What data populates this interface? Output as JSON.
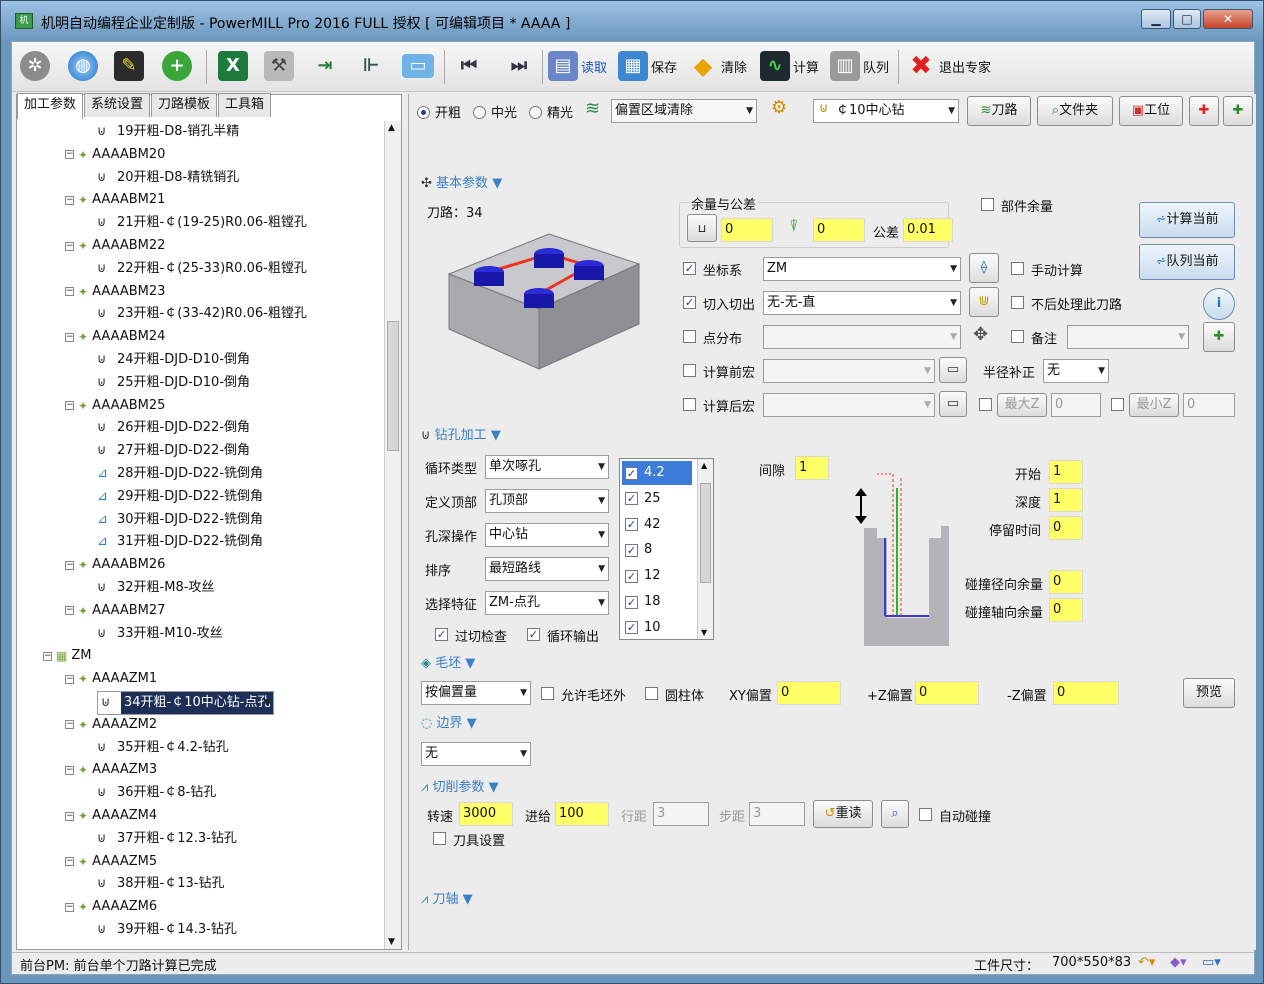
{
  "window": {
    "title": "机明自动编程企业定制版 - PowerMILL Pro 2016 FULL 授权 [ 可编辑项目 * AAAA ]",
    "app_icon": "机"
  },
  "toolbar": {
    "items": [
      {
        "icon": "gear-icon"
      },
      {
        "icon": "globe-icon"
      },
      {
        "icon": "wizard-icon"
      },
      {
        "icon": "add-icon"
      },
      {
        "icon": "excel-icon"
      },
      {
        "icon": "wrench-icon"
      },
      {
        "icon": "import-icon"
      },
      {
        "icon": "tree-icon"
      },
      {
        "icon": "folder-icon"
      },
      {
        "icon": "first-icon"
      },
      {
        "icon": "last-icon"
      }
    ],
    "read_label": "读取",
    "save_label": "保存",
    "clear_label": "清除",
    "calc_label": "计算",
    "queue_label": "队列",
    "exit_label": "退出专家"
  },
  "left_tabs": [
    "加工参数",
    "系统设置",
    "刀路模板",
    "工具箱"
  ],
  "tree": [
    {
      "level": 2,
      "text": "19开粗-D8-销孔半精",
      "type": "op"
    },
    {
      "level": 1,
      "text": "AAAABM20",
      "type": "group"
    },
    {
      "level": 2,
      "text": "20开粗-D8-精铣销孔",
      "type": "op"
    },
    {
      "level": 1,
      "text": "AAAABM21",
      "type": "group"
    },
    {
      "level": 2,
      "text": "21开粗-￠(19-25)R0.06-粗镗孔",
      "type": "op"
    },
    {
      "level": 1,
      "text": "AAAABM22",
      "type": "group"
    },
    {
      "level": 2,
      "text": "22开粗-￠(25-33)R0.06-粗镗孔",
      "type": "op"
    },
    {
      "level": 1,
      "text": "AAAABM23",
      "type": "group"
    },
    {
      "level": 2,
      "text": "23开粗-￠(33-42)R0.06-粗镗孔",
      "type": "op"
    },
    {
      "level": 1,
      "text": "AAAABM24",
      "type": "group"
    },
    {
      "level": 2,
      "text": "24开粗-DJD-D10-倒角",
      "type": "op"
    },
    {
      "level": 2,
      "text": "25开粗-DJD-D10-倒角",
      "type": "op"
    },
    {
      "level": 1,
      "text": "AAAABM25",
      "type": "group"
    },
    {
      "level": 2,
      "text": "26开粗-DJD-D22-倒角",
      "type": "op"
    },
    {
      "level": 2,
      "text": "27开粗-DJD-D22-倒角",
      "type": "op"
    },
    {
      "level": 2,
      "text": "28开粗-DJD-D22-铣倒角",
      "type": "op2"
    },
    {
      "level": 2,
      "text": "29开粗-DJD-D22-铣倒角",
      "type": "op2"
    },
    {
      "level": 2,
      "text": "30开粗-DJD-D22-铣倒角",
      "type": "op2"
    },
    {
      "level": 2,
      "text": "31开粗-DJD-D22-铣倒角",
      "type": "op2"
    },
    {
      "level": 1,
      "text": "AAAABM26",
      "type": "group"
    },
    {
      "level": 2,
      "text": "32开粗-M8-攻丝",
      "type": "op"
    },
    {
      "level": 1,
      "text": "AAAABM27",
      "type": "group"
    },
    {
      "level": 2,
      "text": "33开粗-M10-攻丝",
      "type": "op"
    },
    {
      "level": 0,
      "text": "ZM",
      "type": "root"
    },
    {
      "level": 1,
      "text": "AAAAZM1",
      "type": "group"
    },
    {
      "level": 2,
      "text": "34开粗-￠10中心钻-点孔",
      "type": "op",
      "selected": true
    },
    {
      "level": 1,
      "text": "AAAAZM2",
      "type": "group"
    },
    {
      "level": 2,
      "text": "35开粗-￠4.2-钻孔",
      "type": "op"
    },
    {
      "level": 1,
      "text": "AAAAZM3",
      "type": "group"
    },
    {
      "level": 2,
      "text": "36开粗-￠8-钻孔",
      "type": "op"
    },
    {
      "level": 1,
      "text": "AAAAZM4",
      "type": "group"
    },
    {
      "level": 2,
      "text": "37开粗-￠12.3-钻孔",
      "type": "op"
    },
    {
      "level": 1,
      "text": "AAAAZM5",
      "type": "group"
    },
    {
      "level": 2,
      "text": "38开粗-￠13-钻孔",
      "type": "op"
    },
    {
      "level": 1,
      "text": "AAAAZM6",
      "type": "group"
    },
    {
      "level": 2,
      "text": "39开粗-￠14.3-钻孔",
      "type": "op"
    }
  ],
  "header": {
    "radio_rough": "开粗",
    "radio_semi": "中光",
    "radio_finish": "精光",
    "strategy": "偏置区域清除",
    "tool": "￠10中心钻",
    "btn_toolpath": "刀路",
    "btn_folder": "文件夹",
    "btn_workpos": "工位"
  },
  "basic": {
    "section": "基本参数",
    "toolpath_label": "刀路：34",
    "allowance_title": "余量与公差",
    "allowance1": "0",
    "allowance2": "0",
    "tolerance_label": "公差",
    "tolerance": "0.01",
    "part_allowance": "部件余量",
    "calc_current": "计算当前",
    "queue_current": "队列当前",
    "coord_label": "坐标系",
    "coord_value": "ZM",
    "manual_calc": "手动计算",
    "leadin_label": "切入切出",
    "leadin_value": "无-无-直",
    "no_post": "不后处理此刀路",
    "pointdist_label": "点分布",
    "remark_label": "备注",
    "premacro_label": "计算前宏",
    "radcomp_label": "半径补正",
    "radcomp_value": "无",
    "postmacro_label": "计算后宏",
    "maxz_label": "最大Z",
    "maxz_value": "0",
    "minz_label": "最小Z",
    "minz_value": "0"
  },
  "drill": {
    "section": "钻孔加工",
    "cycle_label": "循环类型",
    "cycle_value": "单次啄孔",
    "top_label": "定义顶部",
    "top_value": "孔顶部",
    "depth_label": "孔深操作",
    "depth_value": "中心钻",
    "order_label": "排序",
    "order_value": "最短路线",
    "feature_label": "选择特征",
    "feature_value": "ZM-点孔",
    "gouge_check": "过切检查",
    "cycle_output": "循环输出",
    "diameters": [
      "4.2",
      "25",
      "42",
      "8",
      "12",
      "18",
      "10"
    ],
    "gap_label": "间隙",
    "gap_value": "1",
    "start_label": "开始",
    "start_value": "1",
    "depth2_label": "深度",
    "depth2_value": "1",
    "dwell_label": "停留时间",
    "dwell_value": "0",
    "radial_label": "碰撞径向余量",
    "radial_value": "0",
    "axial_label": "碰撞轴向余量",
    "axial_value": "0"
  },
  "blank": {
    "section": "毛坯",
    "mode": "按偏置量",
    "allow_outside": "允许毛坯外",
    "cylinder": "圆柱体",
    "xy_label": "XY偏置",
    "xy_value": "0",
    "zp_label": "+Z偏置",
    "zp_value": "0",
    "zm_label": "-Z偏置",
    "zm_value": "0",
    "preview": "预览"
  },
  "boundary": {
    "section": "边界",
    "value": "无"
  },
  "cutting": {
    "section": "切削参数",
    "speed_label": "转速",
    "speed_value": "3000",
    "feed_label": "进给",
    "feed_value": "100",
    "stepover_label": "行距",
    "stepover_value": "3",
    "stepdown_label": "步距",
    "stepdown_value": "3",
    "reload": "重读",
    "auto_collision": "自动碰撞",
    "tool_setting": "刀具设置"
  },
  "axis": {
    "section": "刀轴"
  },
  "status": {
    "left": "前台PM: 前台单个刀路计算已完成",
    "size_label": "工件尺寸：",
    "size_value": "700*550*83"
  }
}
